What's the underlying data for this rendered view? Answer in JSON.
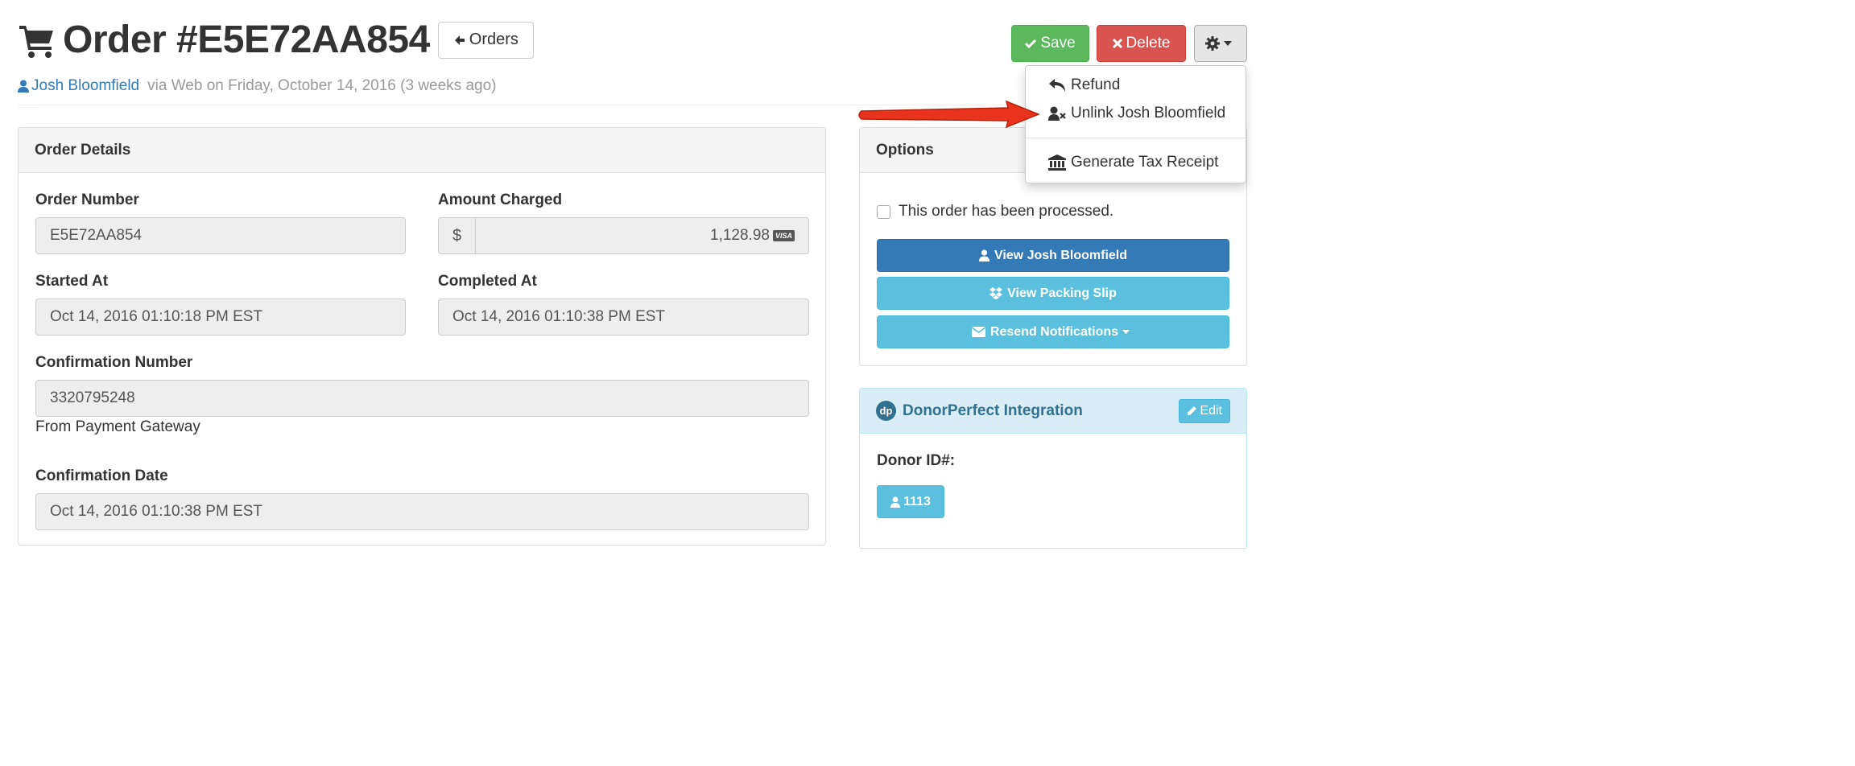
{
  "header": {
    "title": "Order #E5E72AA854",
    "back_label": "Orders",
    "customer": "Josh Bloomfield",
    "via": "via Web on Friday, October 14, 2016 (3 weeks ago)"
  },
  "actions": {
    "save_label": "Save",
    "delete_label": "Delete"
  },
  "dropdown": {
    "items": [
      {
        "label": "Refund",
        "icon": "reply-icon"
      },
      {
        "label": "Unlink Josh Bloomfield",
        "icon": "user-times-icon"
      },
      {
        "label": "Generate Tax Receipt",
        "icon": "bank-icon"
      }
    ]
  },
  "order_details": {
    "heading": "Order Details",
    "order_number_label": "Order Number",
    "order_number": "E5E72AA854",
    "amount_label": "Amount Charged",
    "currency": "$",
    "amount": "1,128.98",
    "card_brand": "VISA",
    "started_label": "Started At",
    "started": "Oct 14, 2016 01:10:18 PM EST",
    "completed_label": "Completed At",
    "completed": "Oct 14, 2016 01:10:38 PM EST",
    "confirmation_label": "Confirmation Number",
    "confirmation": "3320795248",
    "confirmation_help": "From Payment Gateway",
    "confirmation_date_label": "Confirmation Date",
    "confirmation_date": "Oct 14, 2016 01:10:38 PM EST"
  },
  "options": {
    "heading": "Options",
    "processed_label": "This order has been processed.",
    "view_customer_label": "View Josh Bloomfield",
    "packing_slip_label": "View Packing Slip",
    "resend_label": "Resend Notifications"
  },
  "integration": {
    "logo_text": "dp",
    "heading": "DonorPerfect Integration",
    "edit_label": "Edit",
    "donor_label": "Donor ID#:",
    "donor_id": "1113"
  },
  "colors": {
    "save": "#5cb85c",
    "delete": "#d9534f",
    "primary": "#337ab7",
    "info": "#5bc0de",
    "arrow": "#e8341c"
  }
}
